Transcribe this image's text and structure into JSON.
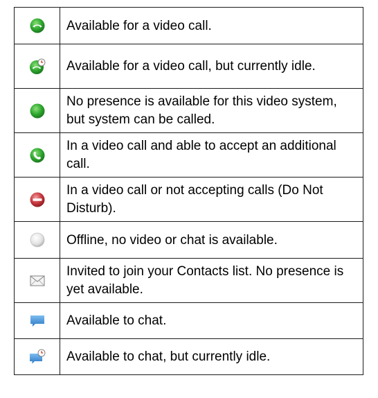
{
  "legend": {
    "rows": [
      {
        "icon": "green-phone-icon",
        "text": "Available for a video call."
      },
      {
        "icon": "green-phone-idle-clock-icon",
        "text": "Available for a video call, but currently idle."
      },
      {
        "icon": "green-dot-icon",
        "text": "No presence is available for this video system, but system can be called."
      },
      {
        "icon": "in-call-phone-icon",
        "text": "In a video call and able to accept an additional call."
      },
      {
        "icon": "do-not-disturb-icon",
        "text": "In a video call or not accepting calls (Do Not Disturb)."
      },
      {
        "icon": "offline-gray-dot-icon",
        "text": "Offline, no video or chat is available."
      },
      {
        "icon": "envelope-icon",
        "text": "Invited to join your Contacts list. No presence is yet available."
      },
      {
        "icon": "chat-bubble-icon",
        "text": "Available to chat."
      },
      {
        "icon": "chat-bubble-idle-clock-icon",
        "text": "Available to chat, but currently idle."
      }
    ]
  },
  "colors": {
    "available_green": "#2fa82f",
    "dnd_red": "#c9383e",
    "offline_gray": "#d7d7d7",
    "chat_blue": "#3f8fd6",
    "border": "#1a1a1a"
  }
}
